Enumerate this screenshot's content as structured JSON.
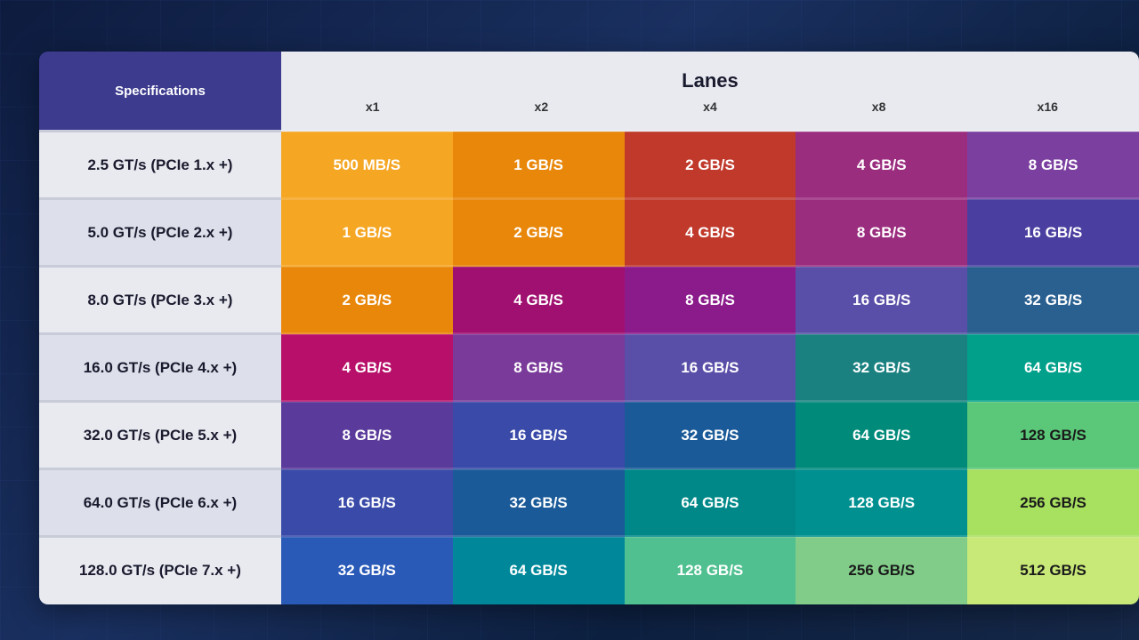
{
  "table": {
    "specHeader": "Specifications",
    "lanesHeader": "Lanes",
    "laneLabels": [
      "x1",
      "x2",
      "x4",
      "x8",
      "x16"
    ],
    "rows": [
      {
        "spec": "2.5 GT/s (PCIe 1.x +)",
        "values": [
          "500 MB/S",
          "1 GB/S",
          "2 GB/S",
          "4 GB/S",
          "8 GB/S"
        ]
      },
      {
        "spec": "5.0 GT/s (PCIe 2.x +)",
        "values": [
          "1 GB/S",
          "2 GB/S",
          "4 GB/S",
          "8 GB/S",
          "16 GB/S"
        ]
      },
      {
        "spec": "8.0 GT/s (PCIe 3.x +)",
        "values": [
          "2 GB/S",
          "4 GB/S",
          "8 GB/S",
          "16 GB/S",
          "32 GB/S"
        ]
      },
      {
        "spec": "16.0 GT/s (PCIe 4.x +)",
        "values": [
          "4 GB/S",
          "8 GB/S",
          "16 GB/S",
          "32 GB/S",
          "64 GB/S"
        ]
      },
      {
        "spec": "32.0 GT/s (PCIe 5.x +)",
        "values": [
          "8 GB/S",
          "16 GB/S",
          "32 GB/S",
          "64 GB/S",
          "128 GB/S"
        ]
      },
      {
        "spec": "64.0 GT/s (PCIe 6.x +)",
        "values": [
          "16 GB/S",
          "32 GB/S",
          "64 GB/S",
          "128 GB/S",
          "256 GB/S"
        ]
      },
      {
        "spec": "128.0 GT/s (PCIe 7.x +)",
        "values": [
          "32 GB/S",
          "64 GB/S",
          "128 GB/S",
          "256 GB/S",
          "512 GB/S"
        ]
      }
    ]
  }
}
